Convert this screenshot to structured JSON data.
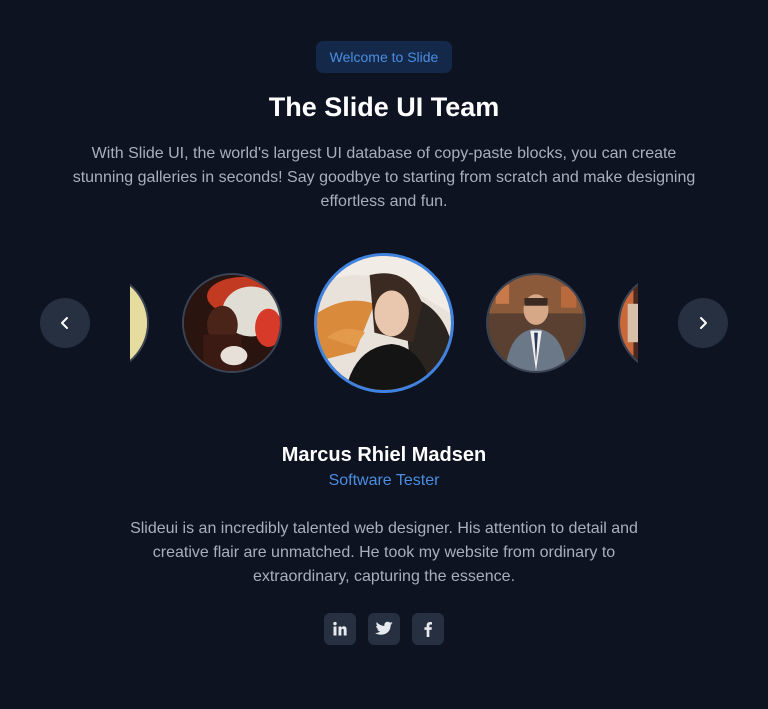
{
  "header": {
    "badge": "Welcome to Slide",
    "title": "The Slide UI Team",
    "description": "With Slide UI, the world's largest UI database of copy-paste blocks, you can create stunning galleries in seconds! Say goodbye to starting from scratch and make designing effortless and fun."
  },
  "carousel": {
    "prev_icon": "chevron-left-icon",
    "next_icon": "chevron-right-icon",
    "active_index": 2,
    "slide_count": 5
  },
  "member": {
    "name": "Marcus Rhiel Madsen",
    "role": "Software Tester",
    "quote": "Slideui is an incredibly talented web designer. His attention to detail and creative flair are unmatched. He took my website from ordinary to extraordinary, capturing the essence."
  },
  "socials": [
    {
      "icon": "linkedin-icon"
    },
    {
      "icon": "twitter-icon"
    },
    {
      "icon": "facebook-icon"
    }
  ],
  "colors": {
    "background": "#0d1321",
    "accent": "#4b8de0",
    "button_bg": "#263040",
    "badge_bg": "#14294a"
  }
}
